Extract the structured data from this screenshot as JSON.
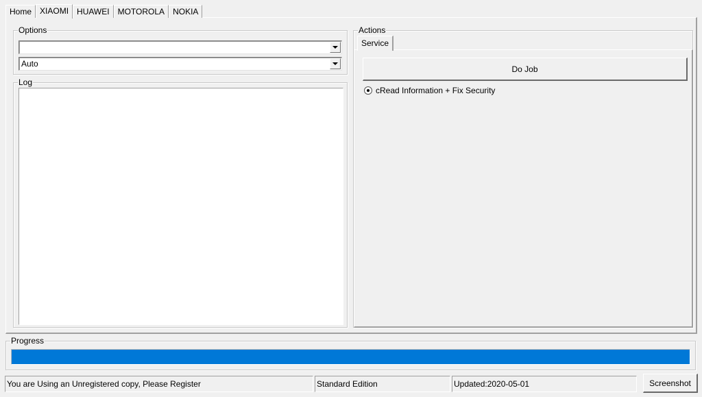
{
  "tabs": [
    {
      "label": "Home",
      "active": false
    },
    {
      "label": "XIAOMI",
      "active": true
    },
    {
      "label": "HUAWEI",
      "active": false
    },
    {
      "label": "MOTOROLA",
      "active": false
    },
    {
      "label": "NOKIA",
      "active": false
    }
  ],
  "options": {
    "title": "Options",
    "combo1_value": "",
    "combo2_value": "Auto"
  },
  "log": {
    "title": "Log"
  },
  "actions": {
    "title": "Actions",
    "tab_label": "Service",
    "do_job_label": "Do Job",
    "radio_label": "cRead Information + Fix Security"
  },
  "progress": {
    "title": "Progress",
    "value_percent": 100,
    "fill_color": "#0078d7"
  },
  "status": {
    "registration": "You are Using an Unregistered copy, Please Register",
    "edition": "Standard Edition",
    "updated": "Updated:2020-05-01",
    "screenshot_label": "Screenshot"
  }
}
